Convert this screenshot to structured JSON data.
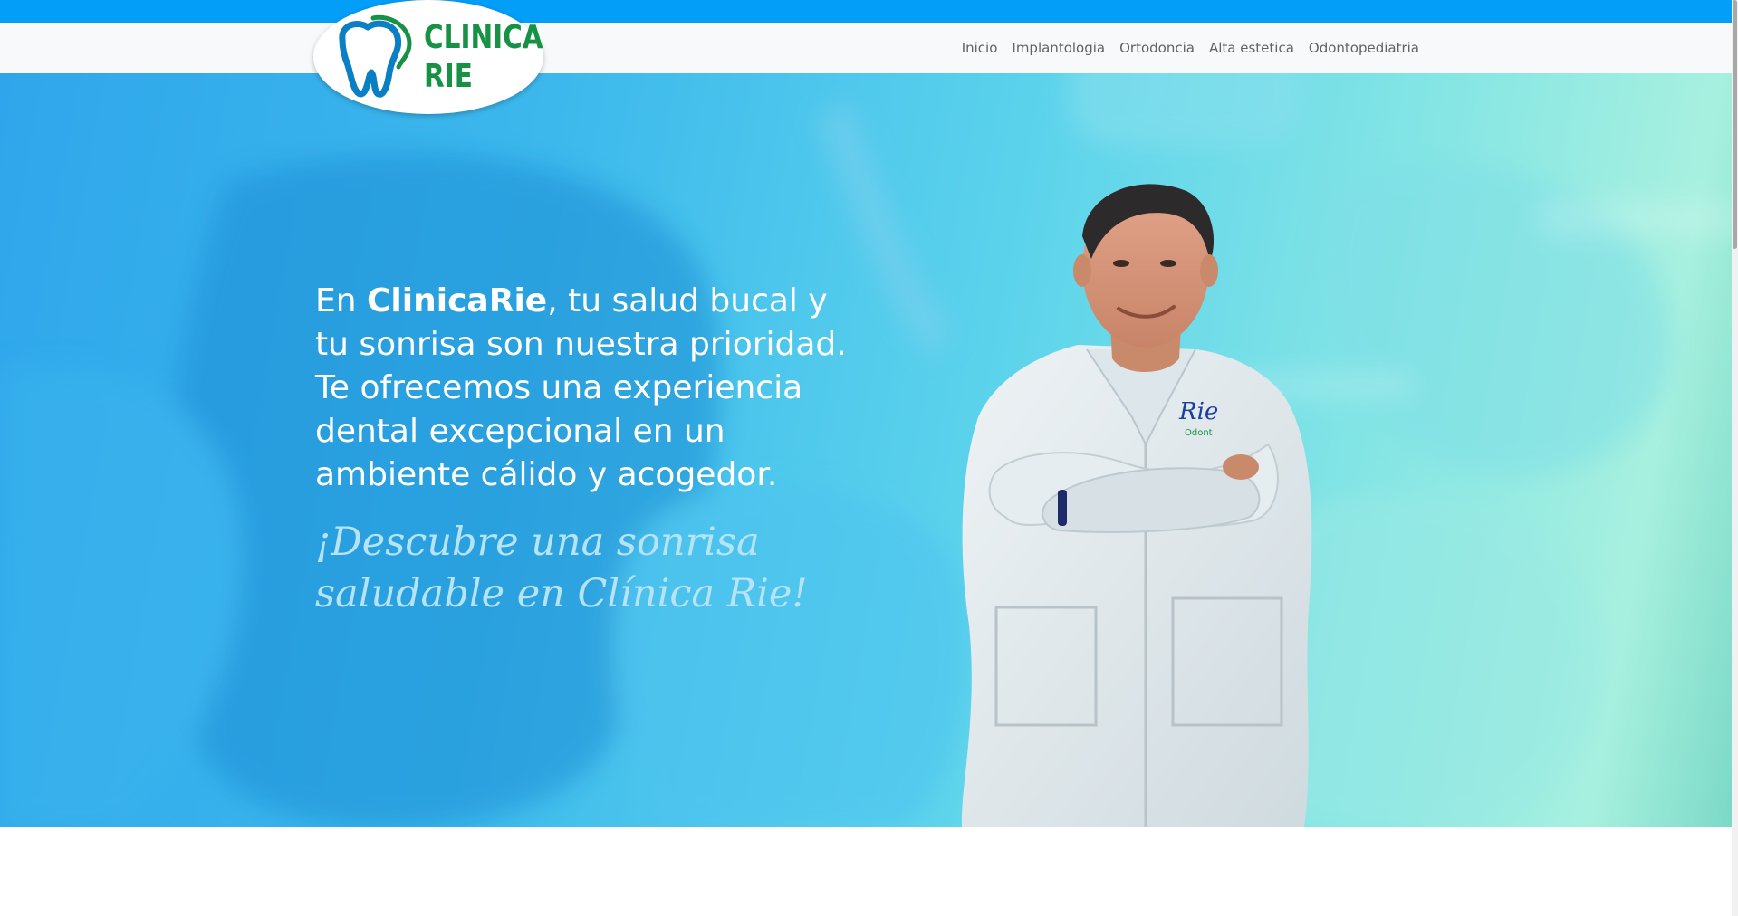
{
  "header": {
    "brand_line1": "CLINICA",
    "brand_line2": "RIE",
    "nav": [
      "Inicio",
      "Implantologia",
      "Ortodoncia",
      "Alta estetica",
      "Odontopediatria"
    ]
  },
  "hero": {
    "headline_prefix": "En ",
    "headline_brand": "ClinicaRie",
    "headline_rest": ", tu salud bucal y tu sonrisa son nuestra prioridad. Te ofrecemos una experiencia dental excepcional en un ambiente cálido y acogedor.",
    "tagline": "¡Descubre una sonrisa saludable en Clínica Rie!",
    "coat_logo_text": "Rie",
    "coat_sub_text": "Odont"
  },
  "colors": {
    "topbar": "#039ef8",
    "brand_green": "#179245",
    "brand_blue": "#0a7fc4"
  }
}
